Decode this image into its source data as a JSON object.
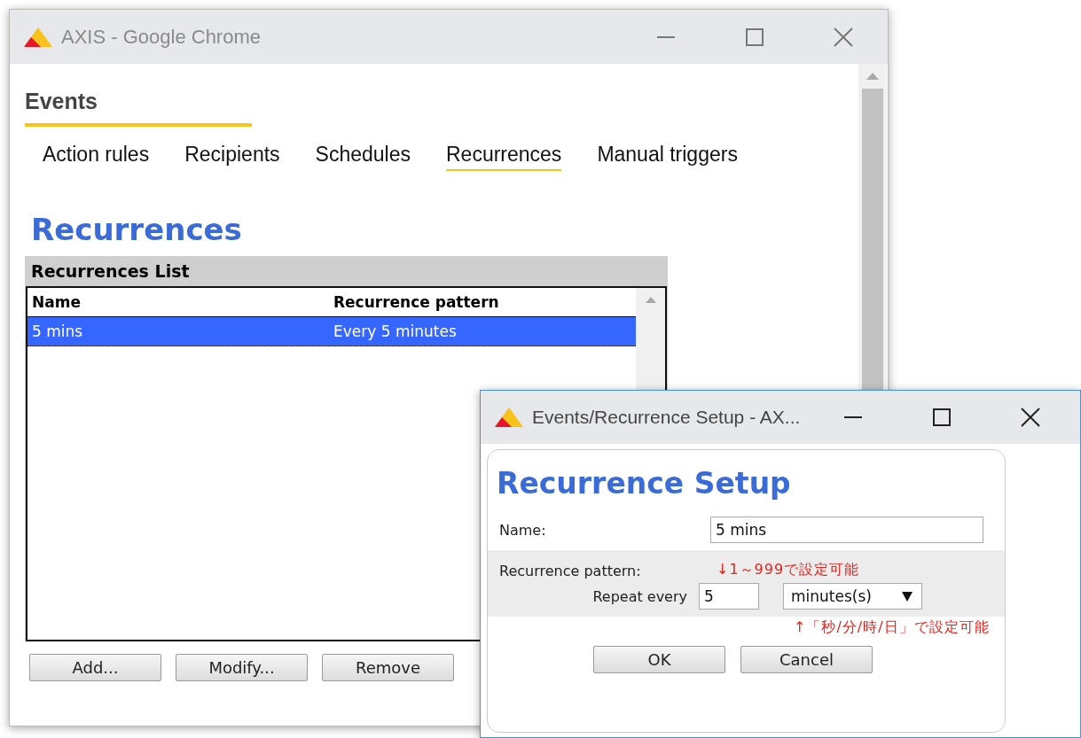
{
  "main_window": {
    "title": "AXIS - Google Chrome",
    "section": "Events",
    "tabs": [
      {
        "label": "Action rules",
        "selected": false
      },
      {
        "label": "Recipients",
        "selected": false
      },
      {
        "label": "Schedules",
        "selected": false
      },
      {
        "label": "Recurrences",
        "selected": true
      },
      {
        "label": "Manual triggers",
        "selected": false
      }
    ],
    "heading": "Recurrences",
    "list": {
      "title": "Recurrences List",
      "columns": [
        "Name",
        "Recurrence pattern"
      ],
      "rows": [
        {
          "cells": [
            "5 mins",
            "Every 5 minutes"
          ],
          "selected": true
        }
      ]
    },
    "buttons": [
      "Add...",
      "Modify...",
      "Remove"
    ]
  },
  "dialog": {
    "title": "Events/Recurrence Setup - AX...",
    "heading": "Recurrence Setup",
    "name_label": "Name:",
    "name_value": "5 mins",
    "pattern_label": "Recurrence pattern:",
    "repeat_label": "Repeat every",
    "repeat_value": "5",
    "unit": "minutes(s)",
    "notes": [
      "↓1～999で設定可能",
      "↑「秒/分/時/日」で設定可能"
    ],
    "buttons": [
      "OK",
      "Cancel"
    ]
  }
}
